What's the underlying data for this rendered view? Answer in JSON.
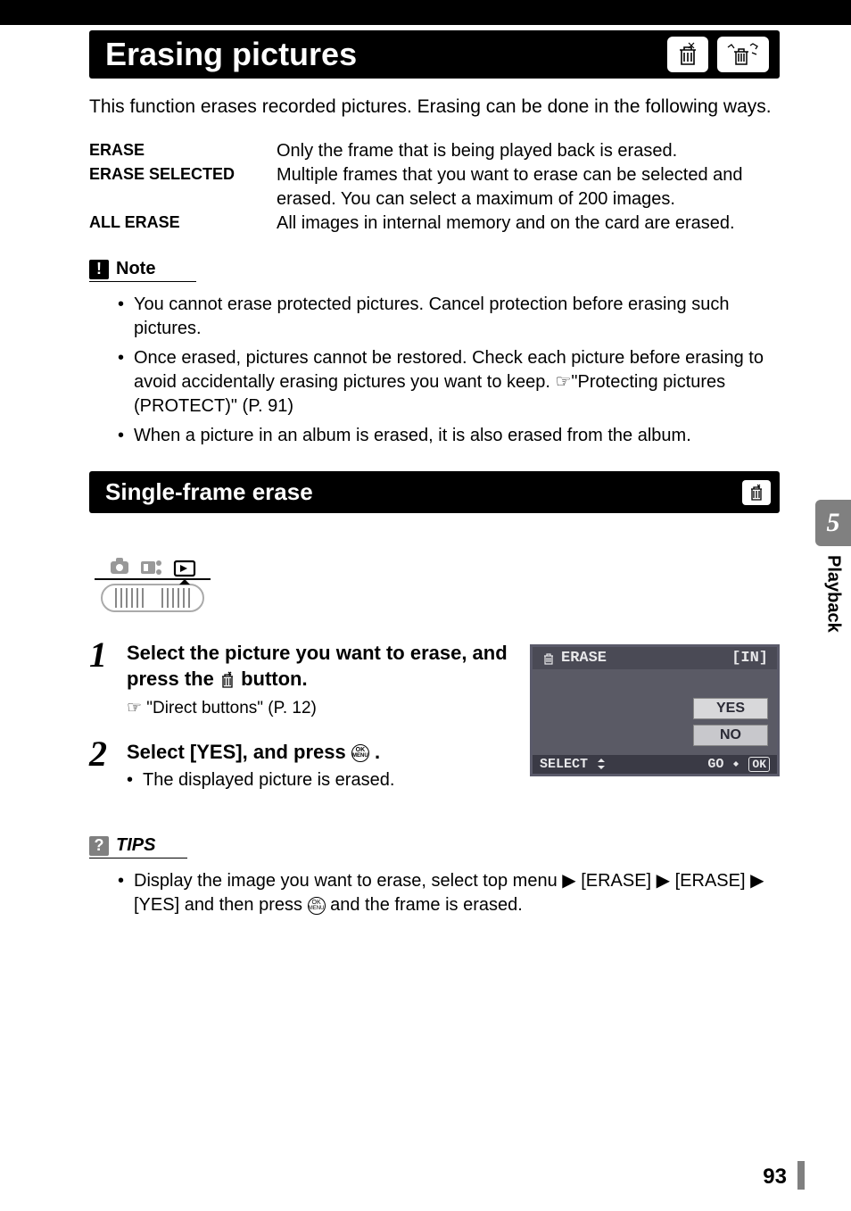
{
  "header": {
    "title": "Erasing pictures"
  },
  "intro": "This function erases recorded pictures. Erasing can be done in the following ways.",
  "definitions": [
    {
      "term": "ERASE",
      "desc": "Only the frame that is being played back is erased."
    },
    {
      "term": "ERASE SELECTED",
      "desc": "Multiple frames that you want to erase can be selected and erased. You can select a maximum of 200 images."
    },
    {
      "term": "ALL ERASE",
      "desc": "All images in internal memory and on the card are erased."
    }
  ],
  "note": {
    "label": "Note",
    "items": [
      "You cannot erase protected pictures. Cancel protection before erasing such pictures.",
      "Once erased, pictures cannot be restored. Check each picture before erasing to avoid accidentally erasing pictures you want to keep. ☞\"Protecting pictures (PROTECT)\" (P. 91)",
      "When a picture in an album is erased, it is also erased from the album."
    ]
  },
  "subsection": {
    "title": "Single-frame erase"
  },
  "steps": [
    {
      "num": "1",
      "title_a": "Select the picture you want to erase, and press the ",
      "title_b": " button.",
      "sub": "☞ \"Direct buttons\" (P. 12)"
    },
    {
      "num": "2",
      "title_a": "Select [YES], and press ",
      "title_b": ".",
      "bullets": [
        "The displayed picture is erased."
      ]
    }
  ],
  "screen": {
    "header_label": "ERASE",
    "header_right": "[IN]",
    "yes": "YES",
    "no": "NO",
    "footer_left": "SELECT",
    "footer_right_a": "GO",
    "footer_right_b": "OK"
  },
  "tips": {
    "label": "TIPS",
    "text_a": "Display the image you want to erase, select top menu  ▶  [ERASE]  ▶  [ERASE]  ▶  [YES] and then press ",
    "text_b": " and the frame is erased."
  },
  "side": {
    "num": "5",
    "label": "Playback"
  },
  "page_number": "93"
}
